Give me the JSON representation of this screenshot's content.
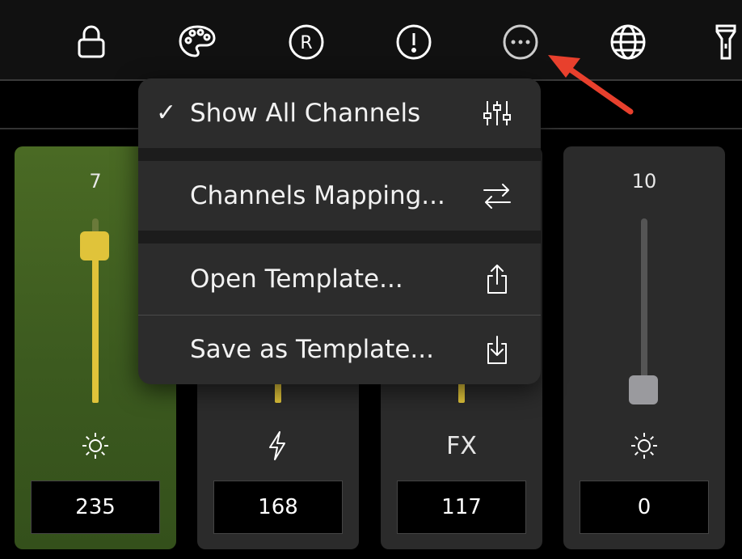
{
  "toolbar": {
    "icons": [
      "lock-icon",
      "palette-icon",
      "registered-icon",
      "exclamation-icon",
      "more-icon",
      "globe-icon",
      "flashlight-icon"
    ],
    "icon_color": "#ffffff",
    "registered_letter": "R"
  },
  "channels": [
    {
      "level": "7",
      "icon": "sun-icon",
      "value": "235",
      "slider_fraction": 0.83,
      "active": true
    },
    {
      "level": "",
      "icon": "bolt-icon",
      "value": "168"
    },
    {
      "level": "",
      "icon": "fx-label",
      "label": "FX",
      "value": "117"
    },
    {
      "level": "10",
      "icon": "sun-icon",
      "value": "0",
      "slider_fraction": 0.0
    }
  ],
  "menu": {
    "items": [
      {
        "label": "Show All Channels",
        "checked": true,
        "check_mark": "✓",
        "icon": "sliders-icon"
      },
      {
        "label": "Channels Mapping...",
        "checked": false,
        "icon": "swap-arrows-icon"
      },
      {
        "label": "Open Template...",
        "checked": false,
        "icon": "share-icon"
      },
      {
        "label": "Save as Template...",
        "checked": false,
        "icon": "download-icon"
      }
    ]
  },
  "colors": {
    "accent_yellow": "#e0c33a",
    "active_channel": "#3f5c20",
    "menu_bg": "#2c2c2c",
    "arrow_red": "#e8402d"
  }
}
